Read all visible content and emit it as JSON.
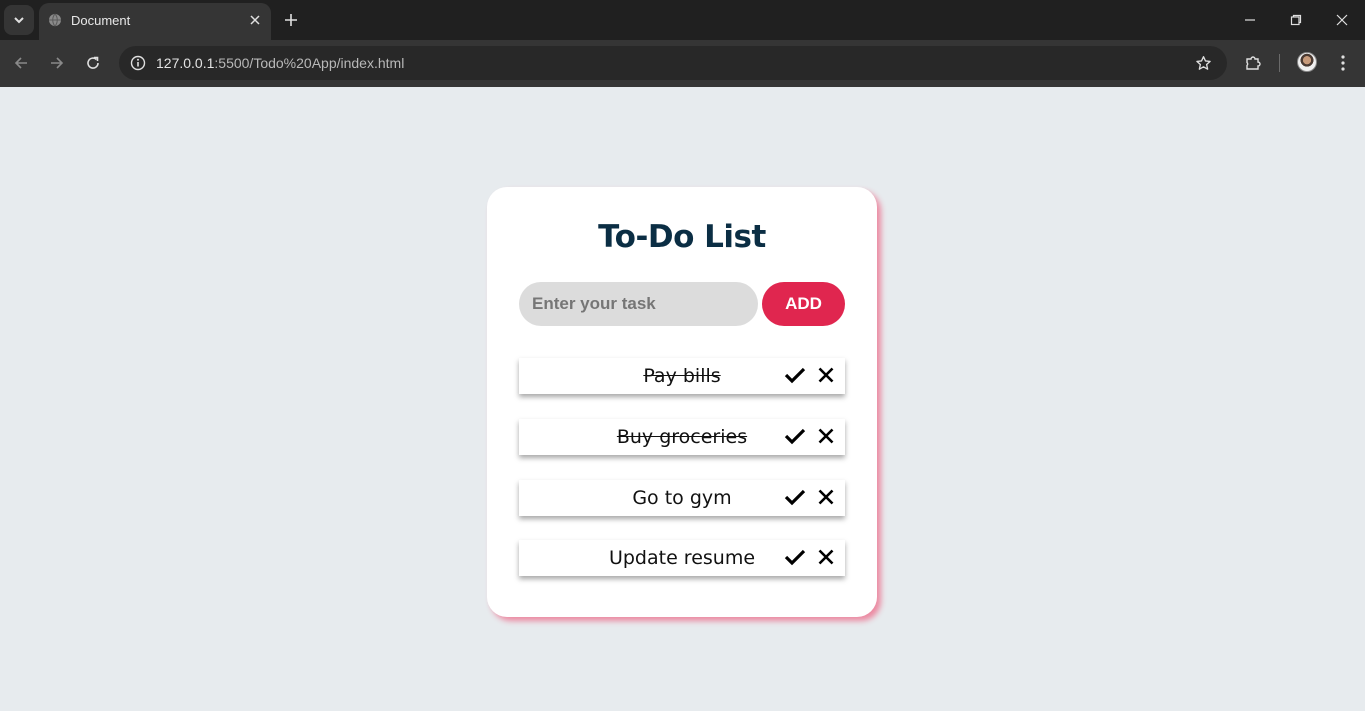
{
  "browser": {
    "tab_title": "Document",
    "url_host": "127.0.0.1",
    "url_rest": ":5500/Todo%20App/index.html"
  },
  "app": {
    "title": "To-Do List",
    "input_placeholder": "Enter your task",
    "input_value": "",
    "add_label": "ADD",
    "accent_color": "#e0264f",
    "title_color": "#0b2e44",
    "tasks": [
      {
        "text": "Pay bills",
        "completed": true
      },
      {
        "text": "Buy groceries",
        "completed": true
      },
      {
        "text": "Go to gym",
        "completed": false
      },
      {
        "text": "Update resume",
        "completed": false
      }
    ]
  },
  "icons": {
    "complete": "check-icon",
    "delete": "close-icon"
  }
}
